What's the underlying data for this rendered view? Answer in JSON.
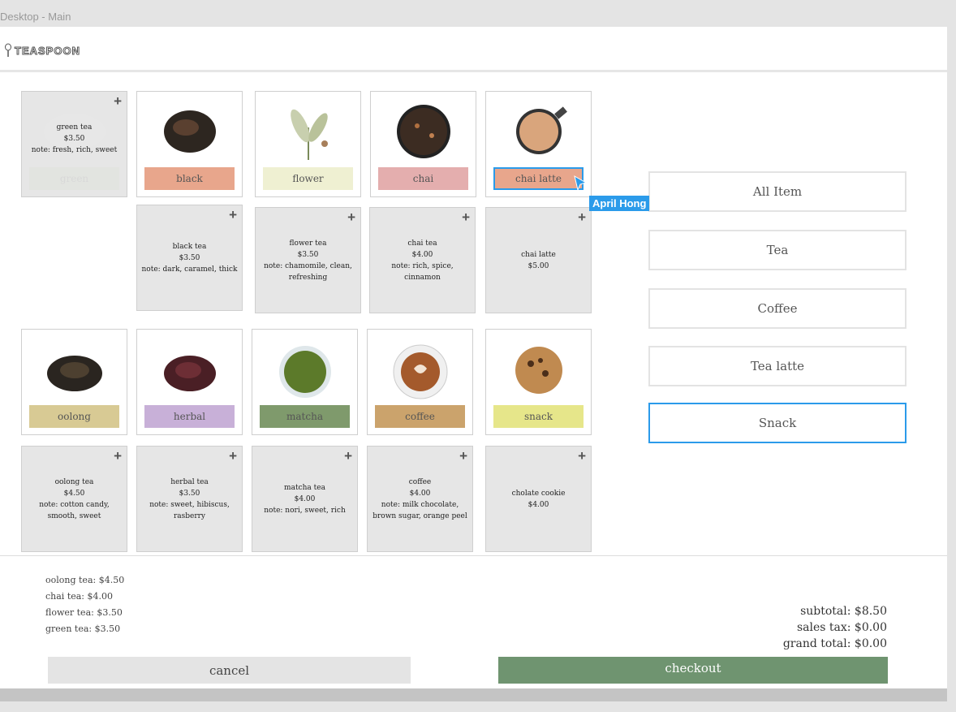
{
  "window_title": "Desktop - Main",
  "brand": "TEASPOON",
  "products": [
    {
      "label": "green",
      "name": "green tea",
      "price": "$3.50",
      "note": "note: fresh, rich, sweet",
      "color": "#e2e4e0"
    },
    {
      "label": "black",
      "name": "black tea",
      "price": "$3.50",
      "note": "note: dark, caramel, thick",
      "color": "#e8a68c"
    },
    {
      "label": "flower",
      "name": "flower tea",
      "price": "$3.50",
      "note": "note: chamomile, clean, refreshing",
      "color": "#eff0d2"
    },
    {
      "label": "chai",
      "name": "chai tea",
      "price": "$4.00",
      "note": "note: rich, spice, cinnamon",
      "color": "#e4aeae"
    },
    {
      "label": "chai latte",
      "name": "chai latte",
      "price": "$5.00",
      "note": "",
      "color": "#e8a68c"
    },
    {
      "label": "oolong",
      "name": "oolong tea",
      "price": "$4.50",
      "note": "note: cotton candy, smooth, sweet",
      "color": "#d8ca94"
    },
    {
      "label": "herbal",
      "name": "herbal tea",
      "price": "$3.50",
      "note": "note: sweet, hibiscus, rasberry",
      "color": "#c8b0d8"
    },
    {
      "label": "matcha",
      "name": "matcha tea",
      "price": "$4.00",
      "note": "note: nori, sweet, rich",
      "color": "#7f9a6c"
    },
    {
      "label": "coffee",
      "name": "coffee",
      "price": "$4.00",
      "note": "note: milk chocolate, brown sugar, orange peel",
      "color": "#cba36c"
    },
    {
      "label": "snack",
      "name": "cholate cookie",
      "price": "$4.00",
      "note": "",
      "color": "#e6e68a"
    }
  ],
  "categories": [
    "All Item",
    "Tea",
    "Coffee",
    "Tea latte",
    "Snack"
  ],
  "selected_category": "Snack",
  "cursor_user": "April Hong",
  "order": [
    "oolong tea: $4.50",
    "chai tea: $4.00",
    "flower tea: $3.50",
    "green tea: $3.50"
  ],
  "totals": {
    "subtotal": "subtotal: $8.50",
    "tax": "sales tax: $0.00",
    "grand": "grand total: $0.00"
  },
  "buttons": {
    "cancel": "cancel",
    "checkout": "checkout"
  },
  "colors": {
    "accent": "#2b9bea",
    "checkout": "#6f9470"
  }
}
